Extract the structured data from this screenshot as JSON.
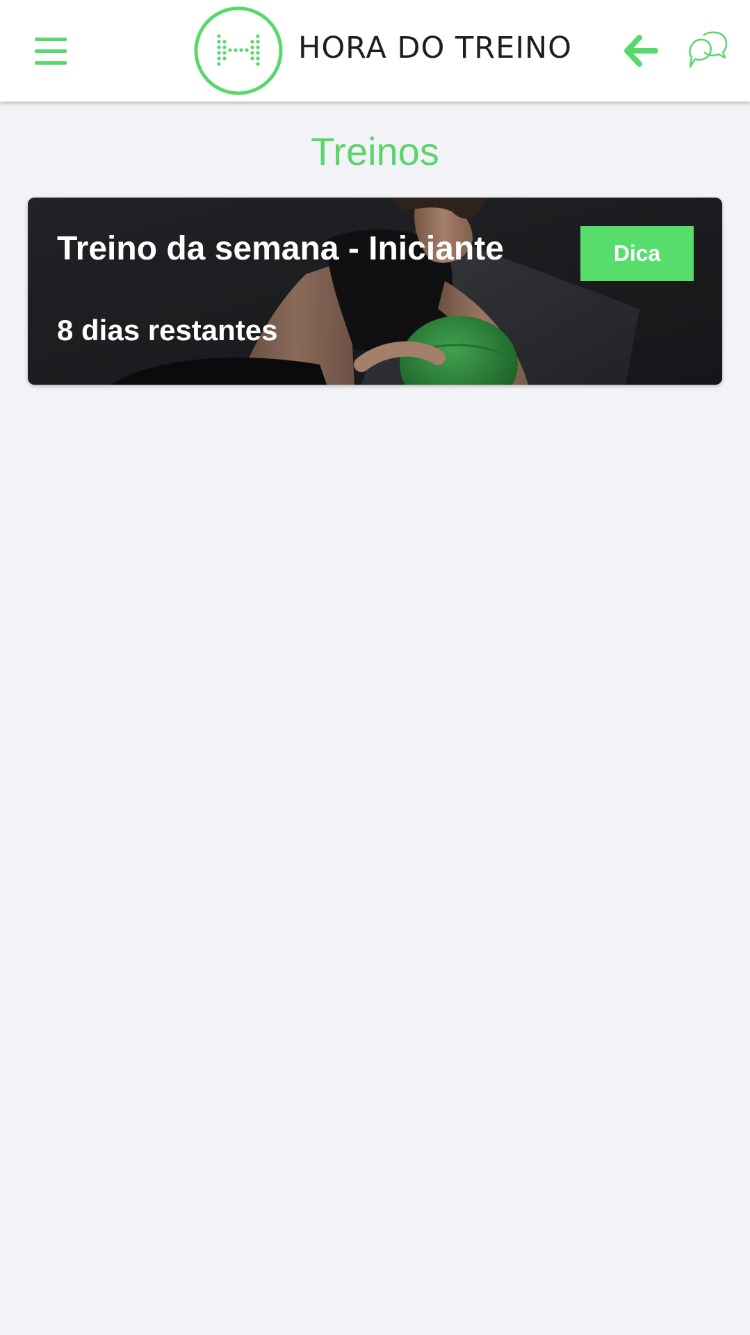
{
  "colors": {
    "accent": "#57d86a",
    "background": "#f2f3f7",
    "header_bg": "#ffffff",
    "logo_text": "#1e1e1e",
    "card_text": "#ffffff",
    "button_bg": "#57dd6b"
  },
  "header": {
    "menu_icon": "hamburger-menu-icon",
    "logo_text": "HORA DO TREINO",
    "back_icon": "arrow-left-icon",
    "chat_icon": "chat-bubbles-icon"
  },
  "main": {
    "title": "Treinos",
    "cards": [
      {
        "title": "Treino da semana - Iniciante",
        "subtitle": "8 dias restantes",
        "button_label": "Dica"
      }
    ]
  }
}
